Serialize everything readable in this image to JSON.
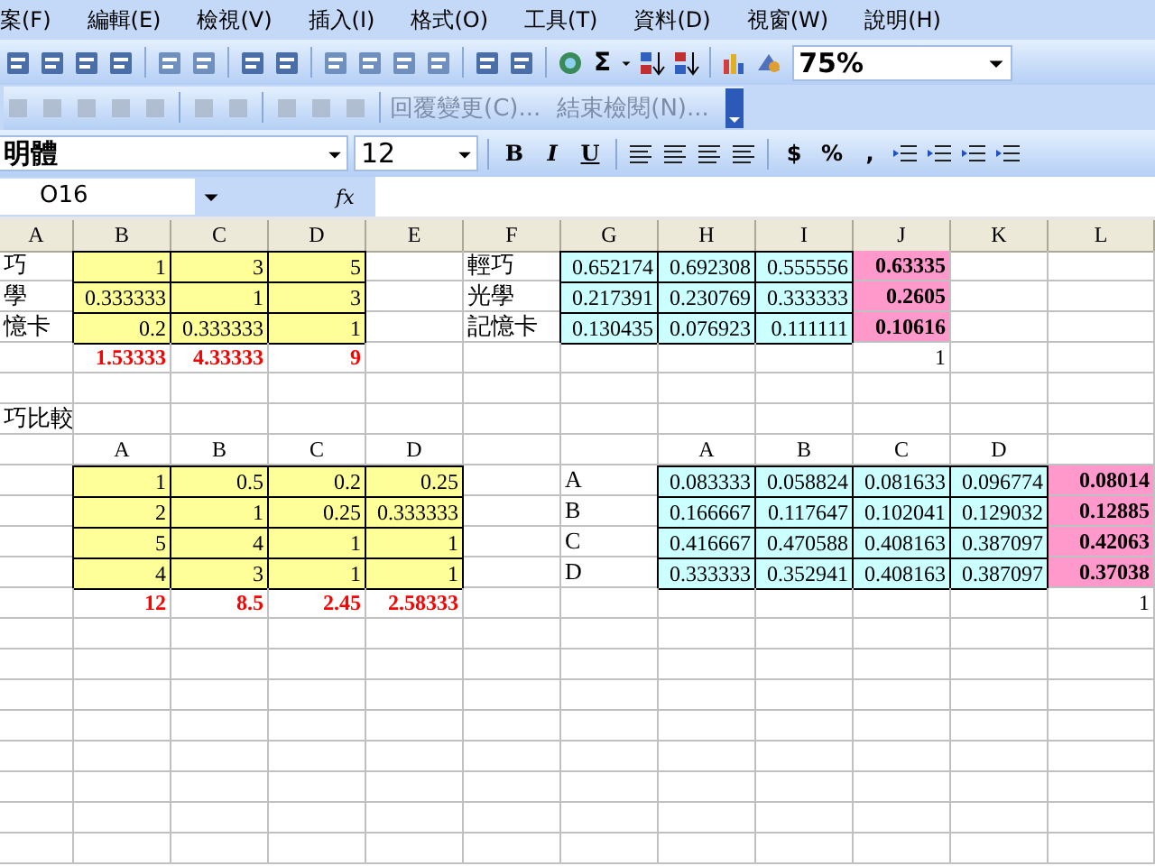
{
  "menu": [
    "案(F)",
    "編輯(E)",
    "檢視(V)",
    "插入(I)",
    "格式(O)",
    "工具(T)",
    "資料(D)",
    "視窗(W)",
    "說明(H)"
  ],
  "standard_toolbar": {
    "sum_symbol": "Σ",
    "zoom": "75%"
  },
  "reviewing_toolbar": {
    "buttons": [
      "回覆變更(C)...",
      "結束檢閱(N)..."
    ]
  },
  "formatting_toolbar": {
    "font": "明體",
    "size": "12",
    "style_buttons": [
      "B",
      "I",
      "U"
    ],
    "number_buttons": [
      "$",
      "%",
      ","
    ]
  },
  "formula_bar": {
    "name_box": "O16",
    "fx": "fx"
  },
  "column_headers": [
    "A",
    "B",
    "C",
    "D",
    "E",
    "F",
    "G",
    "H",
    "I",
    "J",
    "K",
    "L"
  ],
  "rows": [
    {
      "cells": [
        {
          "kind": "label",
          "text": "巧"
        },
        {
          "kind": "input",
          "text": "1"
        },
        {
          "kind": "input",
          "text": "3"
        },
        {
          "kind": "input",
          "text": "5"
        },
        {
          "kind": "blank"
        },
        {
          "kind": "label",
          "text": "輕巧"
        },
        {
          "kind": "norm",
          "text": "0.652174"
        },
        {
          "kind": "norm",
          "text": "0.692308"
        },
        {
          "kind": "norm",
          "text": "0.555556"
        },
        {
          "kind": "weight",
          "text": "0.63335"
        }
      ]
    },
    {
      "cells": [
        {
          "kind": "label",
          "text": "學"
        },
        {
          "kind": "input",
          "text": "0.333333"
        },
        {
          "kind": "input",
          "text": "1"
        },
        {
          "kind": "input",
          "text": "3"
        },
        {
          "kind": "blank"
        },
        {
          "kind": "label",
          "text": "光學"
        },
        {
          "kind": "norm",
          "text": "0.217391"
        },
        {
          "kind": "norm",
          "text": "0.230769"
        },
        {
          "kind": "norm",
          "text": "0.333333"
        },
        {
          "kind": "weight",
          "text": "0.2605"
        }
      ]
    },
    {
      "cells": [
        {
          "kind": "label",
          "text": "憶卡"
        },
        {
          "kind": "input",
          "text": "0.2"
        },
        {
          "kind": "input",
          "text": "0.333333"
        },
        {
          "kind": "input",
          "text": "1"
        },
        {
          "kind": "blank"
        },
        {
          "kind": "label",
          "text": "記憶卡"
        },
        {
          "kind": "norm",
          "text": "0.130435"
        },
        {
          "kind": "norm",
          "text": "0.076923"
        },
        {
          "kind": "norm",
          "text": "0.111111"
        },
        {
          "kind": "weight",
          "text": "0.10616"
        }
      ]
    },
    {
      "cells": [
        {
          "kind": "blank"
        },
        {
          "kind": "total",
          "text": "1.53333"
        },
        {
          "kind": "total",
          "text": "4.33333"
        },
        {
          "kind": "total",
          "text": "9"
        },
        {
          "kind": "blank"
        },
        {
          "kind": "blank"
        },
        {
          "kind": "blank"
        },
        {
          "kind": "blank"
        },
        {
          "kind": "blank"
        },
        {
          "kind": "number",
          "text": "1"
        }
      ]
    },
    {
      "cells": [
        {
          "kind": "blank"
        }
      ]
    },
    {
      "cells": [
        {
          "kind": "label",
          "text": "巧比較"
        }
      ]
    },
    {
      "cells": [
        {
          "kind": "blank"
        },
        {
          "kind": "header",
          "text": "A"
        },
        {
          "kind": "header",
          "text": "B"
        },
        {
          "kind": "header",
          "text": "C"
        },
        {
          "kind": "header",
          "text": "D"
        },
        {
          "kind": "blank"
        },
        {
          "kind": "blank"
        },
        {
          "kind": "header",
          "text": "A"
        },
        {
          "kind": "header",
          "text": "B"
        },
        {
          "kind": "header",
          "text": "C"
        },
        {
          "kind": "header",
          "text": "D"
        }
      ]
    },
    {
      "cells": [
        {
          "kind": "blank"
        },
        {
          "kind": "input",
          "text": "1"
        },
        {
          "kind": "input",
          "text": "0.5"
        },
        {
          "kind": "input",
          "text": "0.2"
        },
        {
          "kind": "input",
          "text": "0.25"
        },
        {
          "kind": "blank"
        },
        {
          "kind": "label",
          "text": "A"
        },
        {
          "kind": "norm",
          "text": "0.083333"
        },
        {
          "kind": "norm",
          "text": "0.058824"
        },
        {
          "kind": "norm",
          "text": "0.081633"
        },
        {
          "kind": "norm",
          "text": "0.096774"
        },
        {
          "kind": "weight",
          "text": "0.08014"
        }
      ]
    },
    {
      "cells": [
        {
          "kind": "blank"
        },
        {
          "kind": "input",
          "text": "2"
        },
        {
          "kind": "input",
          "text": "1"
        },
        {
          "kind": "input",
          "text": "0.25"
        },
        {
          "kind": "input",
          "text": "0.333333"
        },
        {
          "kind": "blank"
        },
        {
          "kind": "label",
          "text": "B"
        },
        {
          "kind": "norm",
          "text": "0.166667"
        },
        {
          "kind": "norm",
          "text": "0.117647"
        },
        {
          "kind": "norm",
          "text": "0.102041"
        },
        {
          "kind": "norm",
          "text": "0.129032"
        },
        {
          "kind": "weight",
          "text": "0.12885"
        }
      ]
    },
    {
      "cells": [
        {
          "kind": "blank"
        },
        {
          "kind": "input",
          "text": "5"
        },
        {
          "kind": "input",
          "text": "4"
        },
        {
          "kind": "input",
          "text": "1"
        },
        {
          "kind": "input",
          "text": "1"
        },
        {
          "kind": "blank"
        },
        {
          "kind": "label",
          "text": "C"
        },
        {
          "kind": "norm",
          "text": "0.416667"
        },
        {
          "kind": "norm",
          "text": "0.470588"
        },
        {
          "kind": "norm",
          "text": "0.408163"
        },
        {
          "kind": "norm",
          "text": "0.387097"
        },
        {
          "kind": "weight",
          "text": "0.42063"
        }
      ]
    },
    {
      "cells": [
        {
          "kind": "blank"
        },
        {
          "kind": "input",
          "text": "4"
        },
        {
          "kind": "input",
          "text": "3"
        },
        {
          "kind": "input",
          "text": "1"
        },
        {
          "kind": "input",
          "text": "1"
        },
        {
          "kind": "blank"
        },
        {
          "kind": "label",
          "text": "D"
        },
        {
          "kind": "norm",
          "text": "0.333333"
        },
        {
          "kind": "norm",
          "text": "0.352941"
        },
        {
          "kind": "norm",
          "text": "0.408163"
        },
        {
          "kind": "norm",
          "text": "0.387097"
        },
        {
          "kind": "weight",
          "text": "0.37038"
        }
      ]
    },
    {
      "cells": [
        {
          "kind": "blank"
        },
        {
          "kind": "total",
          "text": "12"
        },
        {
          "kind": "total",
          "text": "8.5"
        },
        {
          "kind": "total",
          "text": "2.45"
        },
        {
          "kind": "total",
          "text": "2.58333"
        },
        {
          "kind": "blank"
        },
        {
          "kind": "blank"
        },
        {
          "kind": "blank"
        },
        {
          "kind": "blank"
        },
        {
          "kind": "blank"
        },
        {
          "kind": "blank"
        },
        {
          "kind": "number",
          "text": "1"
        }
      ]
    }
  ]
}
